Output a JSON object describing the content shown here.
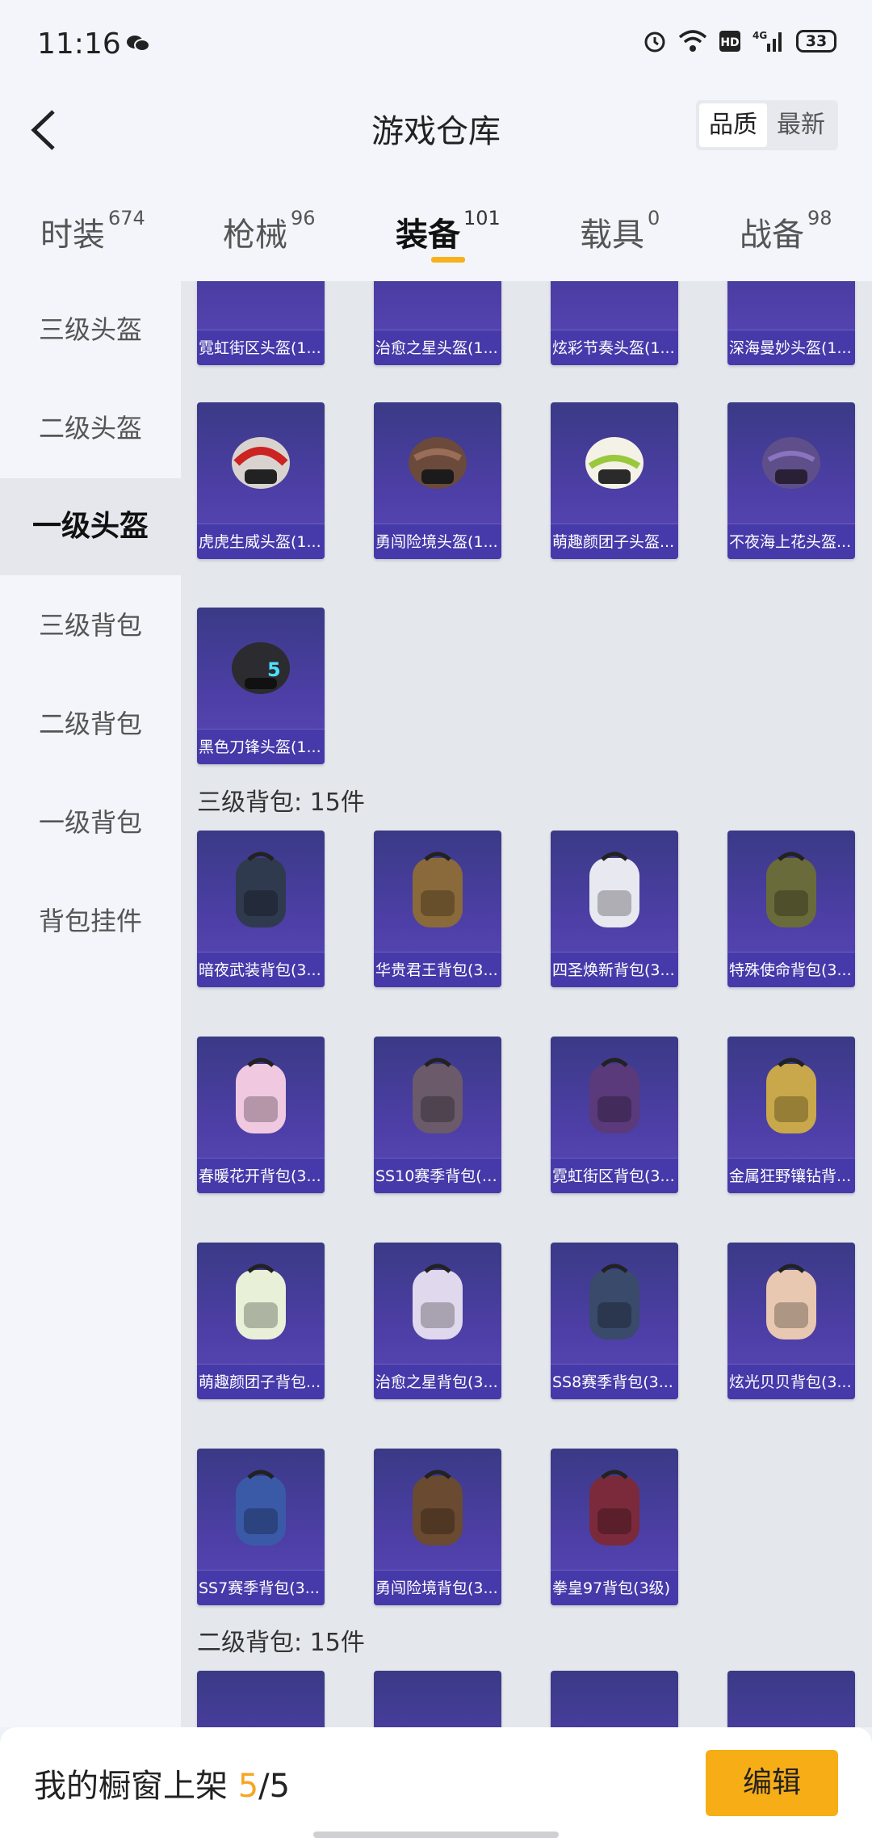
{
  "status": {
    "time": "11:16",
    "battery": "33"
  },
  "header": {
    "title": "游戏仓库",
    "sort_quality": "品质",
    "sort_newest": "最新"
  },
  "tabs": [
    {
      "label": "时装",
      "count": "674"
    },
    {
      "label": "枪械",
      "count": "96"
    },
    {
      "label": "装备",
      "count": "101"
    },
    {
      "label": "载具",
      "count": "0"
    },
    {
      "label": "战备",
      "count": "98"
    }
  ],
  "sidebar": [
    {
      "label": "三级头盔"
    },
    {
      "label": "二级头盔"
    },
    {
      "label": "一级头盔"
    },
    {
      "label": "三级背包"
    },
    {
      "label": "二级背包"
    },
    {
      "label": "一级背包"
    },
    {
      "label": "背包挂件"
    }
  ],
  "content": {
    "top_partial_items": [
      "霓虹街区头盔(1...",
      "治愈之星头盔(1...",
      "炫彩节奏头盔(1...",
      "深海曼妙头盔(1..."
    ],
    "helmet_items": [
      "虎虎生威头盔(1...",
      "勇闯险境头盔(1...",
      "萌趣颜团子头盔...",
      "不夜海上花头盔...",
      "黑色刀锋头盔(1..."
    ],
    "section_backpack3": "三级背包: 15件",
    "backpack3_items": [
      "暗夜武装背包(3...",
      "华贵君王背包(3...",
      "四圣焕新背包(3...",
      "特殊使命背包(3...",
      "春暖花开背包(3...",
      "SS10赛季背包(3...",
      "霓虹街区背包(3...",
      "金属狂野镶钻背...",
      "萌趣颜团子背包...",
      "治愈之星背包(3...",
      "SS8赛季背包(3...",
      "炫光贝贝背包(3...",
      "SS7赛季背包(3...",
      "勇闯险境背包(3...",
      "拳皇97背包(3级)"
    ],
    "section_backpack2": "二级背包: 15件"
  },
  "bottom": {
    "text_prefix": "我的橱窗上架 ",
    "count": "5",
    "total": "/5",
    "edit_label": "编辑"
  },
  "colors": {
    "accent": "#f7ad16",
    "card_purple": "#4e3fa8"
  }
}
